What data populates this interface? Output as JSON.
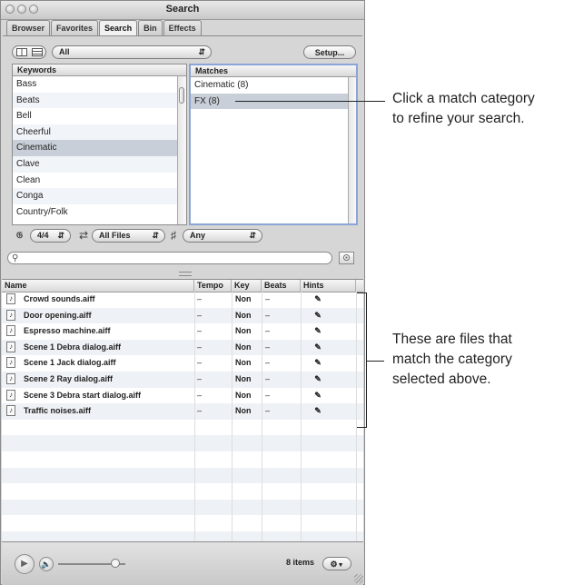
{
  "window": {
    "title": "Search",
    "tabs": [
      "Browser",
      "Favorites",
      "Search",
      "Bin",
      "Effects"
    ],
    "active_tab": "Search"
  },
  "toolbar": {
    "view_column_icon": "column-view-icon",
    "view_list_icon": "list-view-icon",
    "scope_popup": "All",
    "setup_label": "Setup..."
  },
  "keywords": {
    "header": "Keywords",
    "items": [
      "Bass",
      "Beats",
      "Bell",
      "Cheerful",
      "Cinematic",
      "Clave",
      "Clean",
      "Conga",
      "Country/Folk"
    ],
    "selected": "Cinematic"
  },
  "matches": {
    "header": "Matches",
    "items": [
      "Cinematic (8)",
      "FX (8)"
    ],
    "selected": "FX (8)"
  },
  "filters": {
    "meter_icon": "time-signature-icon",
    "meter_value": "4/4",
    "loop_icon": "loop-arrows-icon",
    "files_value": "All Files",
    "key_icon": "key-signature-icon",
    "key_value": "Any"
  },
  "search": {
    "icon": "magnifier-icon",
    "value": "",
    "record_icon": "record-icon"
  },
  "results": {
    "columns": [
      "Name",
      "Tempo",
      "Key",
      "Beats",
      "Hints"
    ],
    "rows": [
      {
        "name": "Crowd sounds.aiff",
        "tempo": "–",
        "key": "Non",
        "beats": "–"
      },
      {
        "name": "Door opening.aiff",
        "tempo": "–",
        "key": "Non",
        "beats": "–"
      },
      {
        "name": "Espresso machine.aiff",
        "tempo": "–",
        "key": "Non",
        "beats": "–"
      },
      {
        "name": "Scene 1 Debra dialog.aiff",
        "tempo": "–",
        "key": "Non",
        "beats": "–"
      },
      {
        "name": "Scene 1 Jack dialog.aiff",
        "tempo": "–",
        "key": "Non",
        "beats": "–"
      },
      {
        "name": "Scene 2 Ray dialog.aiff",
        "tempo": "–",
        "key": "Non",
        "beats": "–"
      },
      {
        "name": "Scene 3 Debra start dialog.aiff",
        "tempo": "–",
        "key": "Non",
        "beats": "–"
      },
      {
        "name": "Traffic noises.aiff",
        "tempo": "–",
        "key": "Non",
        "beats": "–"
      }
    ],
    "empty_rows": 8,
    "file_icon": "audio-file-icon",
    "hint_icon": "hint-document-icon"
  },
  "bottom": {
    "play_icon": "play-icon",
    "volume_icon": "speaker-icon",
    "volume_level": 0.85,
    "items_count": "8 items",
    "action_icon": "gear-icon"
  },
  "callouts": {
    "top": [
      "Click a match category",
      "to refine your search."
    ],
    "bottom": [
      "These are files that",
      "match the category",
      "selected above."
    ]
  }
}
